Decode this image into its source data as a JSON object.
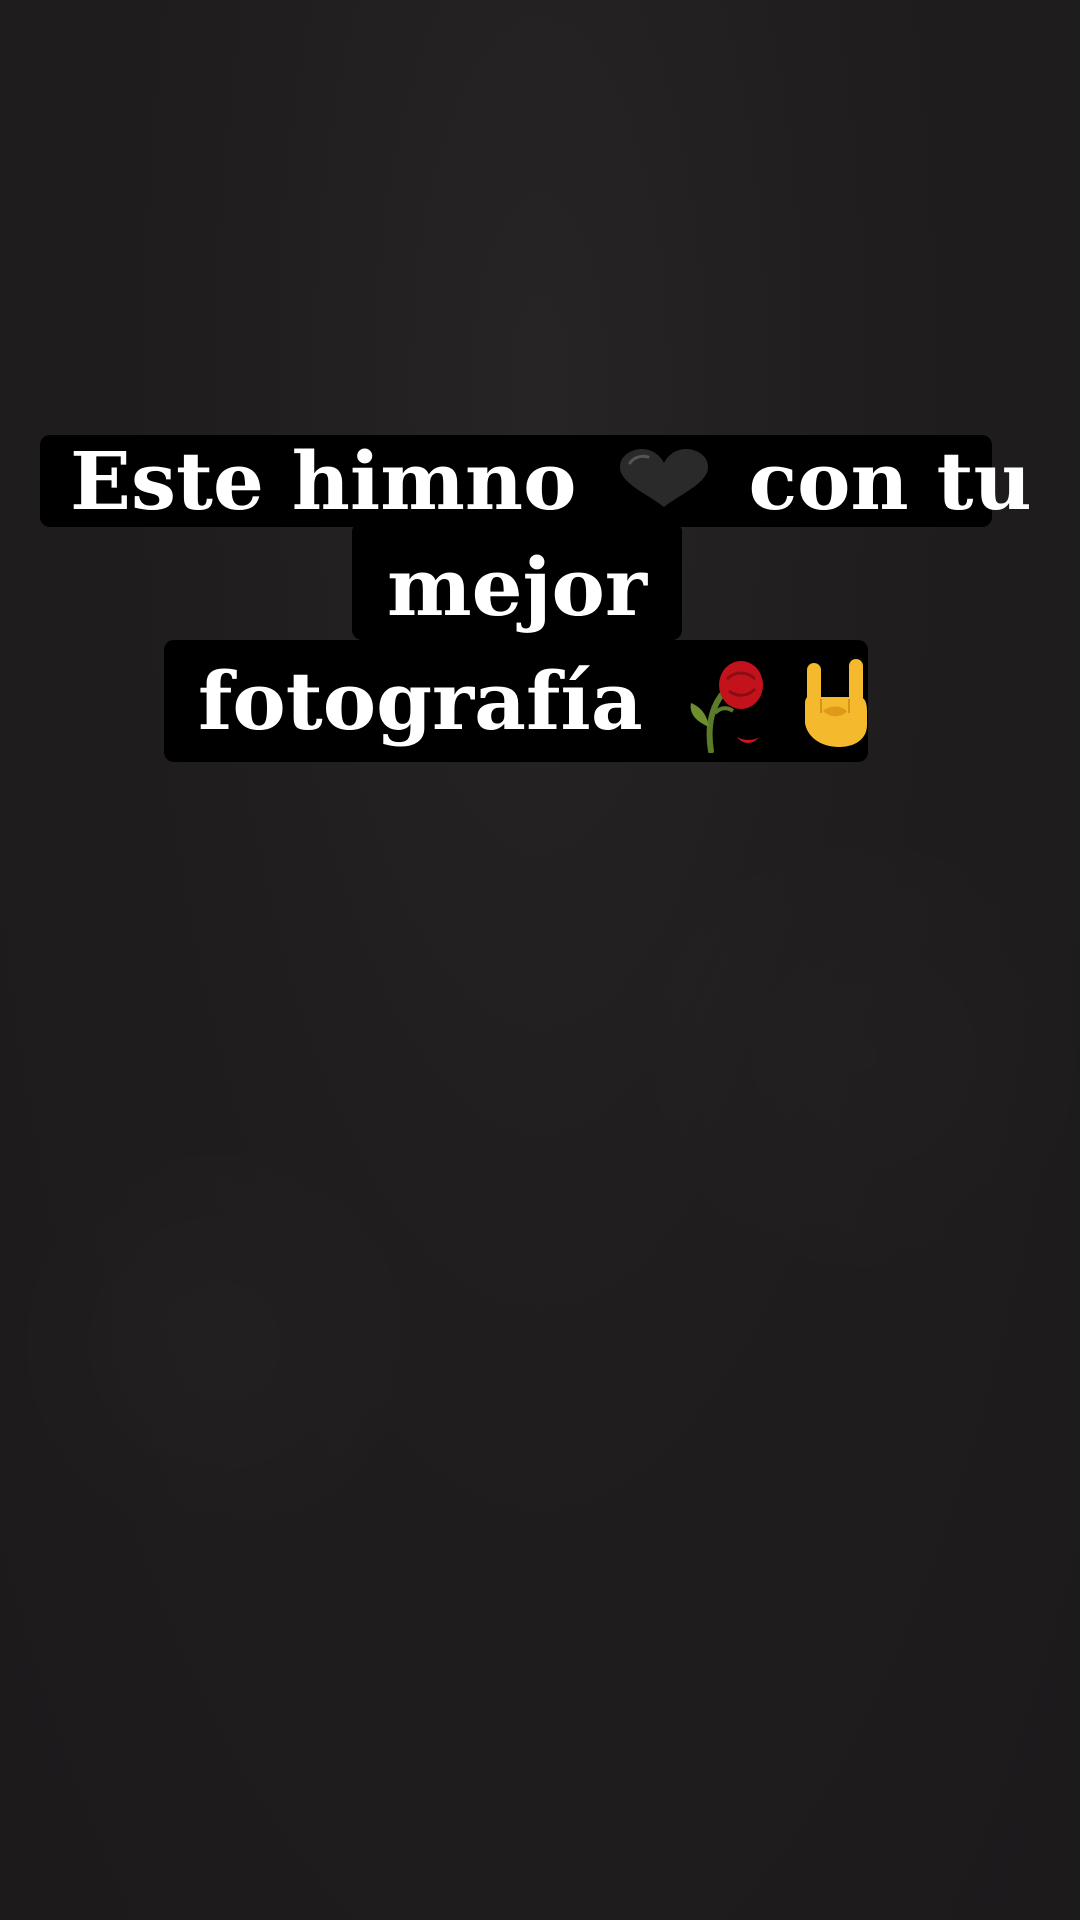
{
  "story": {
    "caption": {
      "line1_part1": "Este himno",
      "line1_part2": "con tu",
      "line2": "mejor",
      "line3": "fotografía"
    },
    "icons": {
      "heart": "black-heart-icon",
      "rose": "wilted-rose-icon",
      "hand": "sign-of-the-horns-icon"
    },
    "colors": {
      "background": "#1f1d1d",
      "caption_box": "#000000",
      "caption_text": "#ffffff"
    }
  }
}
